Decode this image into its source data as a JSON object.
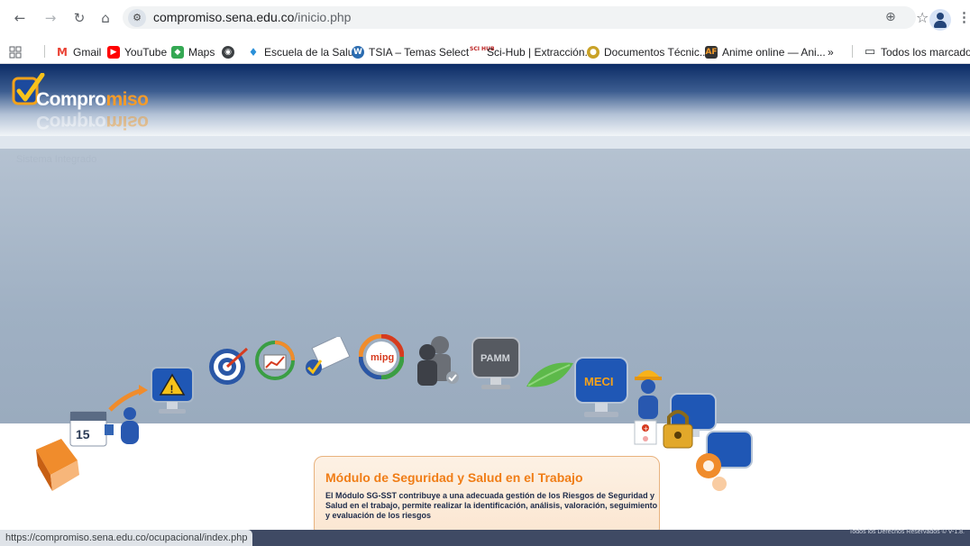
{
  "browser": {
    "url_host": "compromiso.sena.edu.co",
    "url_path": "/inicio.php",
    "status_url": "https://compromiso.sena.edu.co/ocupacional/index.php"
  },
  "bookmarks": {
    "items": [
      {
        "label": "Gmail"
      },
      {
        "label": "YouTube"
      },
      {
        "label": "Maps"
      },
      {
        "label": "Escuela de la Salud"
      },
      {
        "label": "TSIA – Temas Select..."
      },
      {
        "label": "Sci-Hub | Extracción..."
      },
      {
        "label": "Documentos Técnic..."
      },
      {
        "label": "Anime online — Ani..."
      }
    ],
    "overflow": "»",
    "all_bookmarks": "Todos los marcadores"
  },
  "site": {
    "logo_main": "Compromiso",
    "logo_prefix": "Compro",
    "logo_accent": "miso",
    "logo_reflect": "Compromiso",
    "module_title": "Módulo de Seguridad y Salud en el Trabajo",
    "module_description": "El Módulo SG-SST contribuye a una adecuada gestión de los Riesgos de Seguridad y Salud en el trabajo, permite realizar la identificación, análisis, valoración, seguimiento y evaluación de los riesgos",
    "footer_copyright": "Todos los Derechos Reservados © V-1.8."
  },
  "modules": {
    "calendar_day": "15",
    "mipg_label": "mipg",
    "pamm_label": "PAMM",
    "meci_label": "MECI"
  },
  "colors": {
    "accent_orange": "#f07d16",
    "header_dark_blue": "#0c2c66",
    "card_border": "#e8b27e"
  }
}
